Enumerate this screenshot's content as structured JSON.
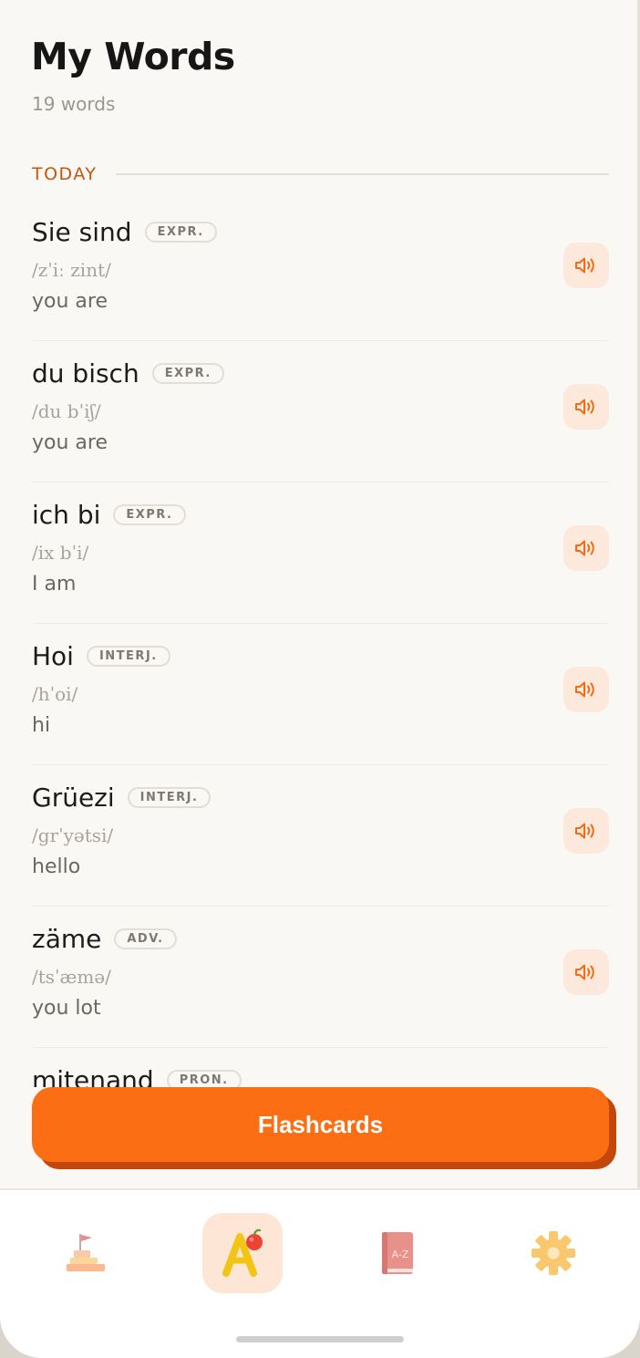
{
  "header": {
    "title": "My Words",
    "count": "19 words"
  },
  "section": {
    "label": "TODAY"
  },
  "words": [
    {
      "word": "Sie sind",
      "pos": "EXPR.",
      "pron": "/zˈiː zint/",
      "meaning": "you are"
    },
    {
      "word": "du bisch",
      "pos": "EXPR.",
      "pron": "/du bˈiʃ/",
      "meaning": "you are"
    },
    {
      "word": "ich bi",
      "pos": "EXPR.",
      "pron": "/ix bˈi/",
      "meaning": "I am"
    },
    {
      "word": "Hoi",
      "pos": "INTERJ.",
      "pron": "/hˈoi/",
      "meaning": "hi"
    },
    {
      "word": "Grüezi",
      "pos": "INTERJ.",
      "pron": "/grˈyətsi/",
      "meaning": "hello"
    },
    {
      "word": "zäme",
      "pos": "ADV.",
      "pron": "/tsˈæmə/",
      "meaning": "you lot"
    },
    {
      "word": "mitenand",
      "pos": "PRON.",
      "pron": "",
      "meaning": ""
    }
  ],
  "actions": {
    "flashcards_label": "Flashcards"
  },
  "tabs": [
    {
      "icon": "pagoda-flag-icon",
      "active": false
    },
    {
      "icon": "letter-a-apple-icon",
      "active": true
    },
    {
      "icon": "dictionary-book-icon",
      "active": false,
      "icon_text": "A-Z"
    },
    {
      "icon": "gear-icon",
      "active": false
    }
  ],
  "colors": {
    "accent": "#fb6e14",
    "accent_shadow": "#c2470a",
    "section_label": "#c2570c",
    "speaker_bg": "#fde9db",
    "background": "#faf8f5"
  }
}
